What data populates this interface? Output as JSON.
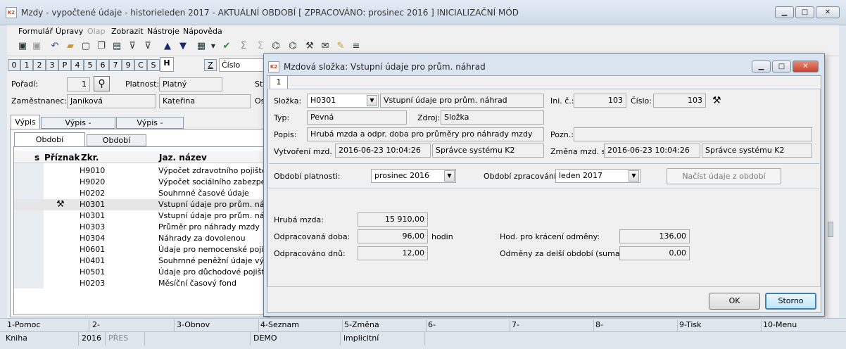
{
  "window": {
    "title": "Mzdy - vypočtené údaje - historie",
    "period_info": "leden 2017 - AKTUÁLNÍ OBDOBÍ [ ZPRACOVÁNO: prosinec 2016 ]  INICIALIZAČNÍ MÓD"
  },
  "menu": [
    "Formulář",
    "Úpravy",
    "Olap",
    "Zobrazit",
    "Nástroje",
    "Nápověda"
  ],
  "toolbar_icons": [
    "save-icon",
    "save-as-icon",
    "undo-icon",
    "open-folder-icon",
    "new-document-icon",
    "copy-icon",
    "book-icon",
    "filter-icon",
    "filter-edit-icon",
    "arrow-up-icon",
    "arrow-down-icon",
    "print-icon",
    "dropdown-icon",
    "check-icon",
    "sum-icon",
    "sum-disabled-icon",
    "binoculars-icon",
    "binoculars-next-icon",
    "tools-icon",
    "mail-icon",
    "notepad-icon",
    "menu-icon"
  ],
  "num_tabs": [
    "0",
    "1",
    "2",
    "3",
    "P",
    "4",
    "5",
    "6",
    "7",
    "9",
    "C",
    "S",
    "H"
  ],
  "sort_tab": {
    "key": "Z",
    "label": "Číslo"
  },
  "main": {
    "poradi_label": "Pořadí:",
    "poradi_value": "1",
    "platnost_label": "Platnost:",
    "platnost_value": "Platný",
    "st_label": "St",
    "zamestnanec_label": "Zaměstnanec:",
    "zamestnanec_last": "Janíková",
    "zamestnanec_first": "Kateřina",
    "os_label": "Os",
    "tabs": [
      "Výpis",
      "Výpis - zaměstnanec",
      "Výpis - organizace"
    ],
    "subtabs": [
      "Období zpracování",
      "Období platnosti"
    ],
    "columns": {
      "s": "s",
      "priznak": "Příznak",
      "zkr": "Zkr.",
      "jaz": "Jaz. název"
    },
    "rows": [
      {
        "zkr": "H9010",
        "name": "Výpočet zdravotního pojištění"
      },
      {
        "zkr": "H9020",
        "name": "Výpočet sociálního zabezpečení"
      },
      {
        "zkr": "H0202",
        "name": "Souhrnné časové údaje"
      },
      {
        "zkr": "H0301",
        "name": "Vstupní údaje pro prům. náhrad"
      },
      {
        "zkr": "H0301",
        "name": "Vstupní údaje pro prům. náhrad"
      },
      {
        "zkr": "H0303",
        "name": "Průměr pro náhrady mzdy"
      },
      {
        "zkr": "H0304",
        "name": "Náhrady za dovolenou"
      },
      {
        "zkr": "H0601",
        "name": "Údaje pro nemocenské pojištění"
      },
      {
        "zkr": "H0401",
        "name": "Souhrnné peněžní údaje výplaty"
      },
      {
        "zkr": "H0501",
        "name": "Údaje pro důchodové pojištění"
      },
      {
        "zkr": "H0203",
        "name": "Měsíční časový fond"
      }
    ]
  },
  "dialog": {
    "title": "Mzdová složka: Vstupní údaje pro prům. náhrad",
    "tab": "1",
    "slozka_label": "Složka:",
    "slozka_code": "H0301",
    "slozka_name": "Vstupní údaje pro prům. náhrad",
    "ini_label": "Ini. č.:",
    "ini_value": "103",
    "cislo_label": "Číslo:",
    "cislo_value": "103",
    "typ_label": "Typ:",
    "typ_value": "Pevná",
    "zdroj_label": "Zdroj:",
    "zdroj_value": "Složka",
    "popis_label": "Popis:",
    "popis_value": "Hrubá mzda a odpr. doba pro průměry pro náhrady mzdy",
    "pozn_label": "Pozn.:",
    "pozn_value": "",
    "vytvoreni_label": "Vytvoření mzd. sl:",
    "vytvoreni_date": "2016-06-23 10:04:26",
    "vytvoreni_user": "Správce systému K2",
    "zmena_label": "Změna mzd. sl:",
    "zmena_date": "2016-06-23 10:04:26",
    "zmena_user": "Správce systému K2",
    "obdobi_platnosti_label": "Období platnosti:",
    "obdobi_platnosti_value": "prosinec 2016",
    "obdobi_zpracovani_label": "Období zpracování:",
    "obdobi_zpracovani_value": "leden 2017",
    "nacist_label": "Načíst údaje z období",
    "hruba_label": "Hrubá mzda:",
    "hruba_value": "15 910,00",
    "odpr_doba_label": "Odpracovaná doba:",
    "odpr_doba_value": "96,00",
    "hodin_label": "hodin",
    "odpr_dnu_label": "Odpracováno dnů:",
    "odpr_dnu_value": "12,00",
    "hod_kraceni_label": "Hod. pro krácení odměny:",
    "hod_kraceni_value": "136,00",
    "odmeny_label": "Odměny za delší období (suma):",
    "odmeny_value": "0,00",
    "ok_label": "OK",
    "storno_label": "Storno"
  },
  "fkeys": [
    "1-Pomoc",
    "2-",
    "3-Obnov",
    "4-Seznam",
    "5-Změna",
    "6-",
    "7-",
    "8-",
    "9-Tisk",
    "10-Menu"
  ],
  "status": {
    "kniha": "Kniha",
    "year": "2016",
    "pres": "PŘES",
    "demo": "DEMO",
    "implicit": "implicitní"
  },
  "colors": {
    "accent": "#c8412c",
    "title_bg": "#dbe5f1",
    "dialog_bg": "#f0f0f0"
  }
}
